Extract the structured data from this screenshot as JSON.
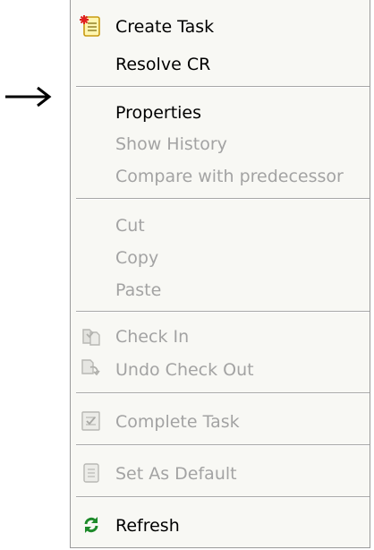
{
  "colors": {
    "menu_background": "#f8f8f4",
    "separator": "#a8a8a8",
    "enabled_text": "#000000",
    "disabled_text": "#a3a3a3"
  },
  "pointer": {
    "icon": "right-arrow-icon"
  },
  "menu": {
    "items": [
      {
        "label": "Create Task",
        "enabled": true,
        "icon": "create-task-icon"
      },
      {
        "label": "Resolve CR",
        "enabled": true
      },
      {
        "label": "Properties",
        "enabled": true
      },
      {
        "label": "Show History",
        "enabled": false
      },
      {
        "label": "Compare with predecessor",
        "enabled": false
      },
      {
        "label": "Cut",
        "enabled": false
      },
      {
        "label": "Copy",
        "enabled": false
      },
      {
        "label": "Paste",
        "enabled": false
      },
      {
        "label": "Check In",
        "enabled": false,
        "icon": "check-in-icon"
      },
      {
        "label": "Undo Check Out",
        "enabled": false,
        "icon": "undo-check-out-icon"
      },
      {
        "label": "Complete Task",
        "enabled": false,
        "icon": "complete-task-icon"
      },
      {
        "label": "Set As Default",
        "enabled": false,
        "icon": "set-as-default-icon"
      },
      {
        "label": "Refresh",
        "enabled": true,
        "icon": "refresh-icon"
      }
    ]
  }
}
